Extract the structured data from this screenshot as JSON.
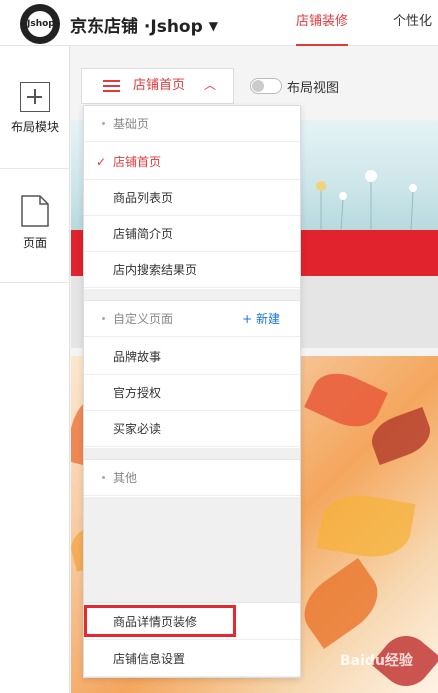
{
  "header": {
    "logo_text": "Jshop",
    "brand": "京东店铺 ·Jshop",
    "brand_arrow": "▼",
    "tabs": [
      {
        "label": "店铺装修",
        "active": true
      },
      {
        "label": "个性化",
        "active": false
      }
    ]
  },
  "sidebar": {
    "items": [
      {
        "label": "布局模块",
        "icon": "plus-box-icon"
      },
      {
        "label": "页面",
        "icon": "page-icon"
      }
    ]
  },
  "toolbar": {
    "page_select_label": "店铺首页",
    "page_select_chevron": "︿",
    "layout_view_label": "布局视图",
    "layout_view_on": false
  },
  "menu": {
    "basic_section": "基础页",
    "basic_items": [
      "店铺首页",
      "商品列表页",
      "店铺简介页",
      "店内搜索结果页"
    ],
    "selected": "店铺首页",
    "custom_section": "自定义页面",
    "new_link": "+ 新建",
    "custom_items": [
      "品牌故事",
      "官方授权",
      "买家必读"
    ],
    "other_section": "其他",
    "bottom_items": [
      "商品详情页装修",
      "店铺信息设置"
    ],
    "highlighted": "商品详情页装修"
  },
  "watermark": "Baidu经验",
  "colors": {
    "accent": "#e4393c",
    "link": "#1a73e8",
    "highlight": "#e8272e"
  }
}
